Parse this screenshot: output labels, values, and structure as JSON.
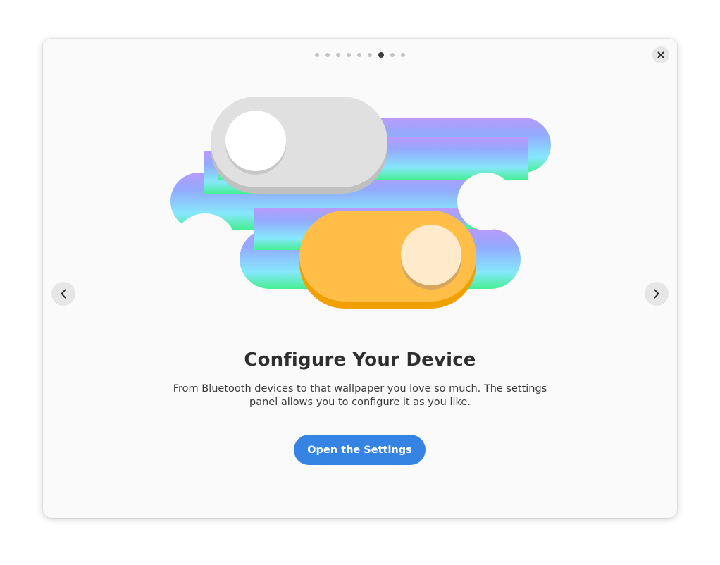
{
  "dialog": {
    "title": "Configure Your Device",
    "description": "From Bluetooth devices to that wallpaper you love so much. The settings panel allows you to configure it as you like.",
    "primary_button": "Open the Settings"
  },
  "pager": {
    "total_pages": 9,
    "current_page": 7
  },
  "icons": {
    "close": "close-icon",
    "previous": "chevron-left-icon",
    "next": "chevron-right-icon"
  },
  "colors": {
    "accent": "#3584e4",
    "toggle_on": "#ffbe48",
    "toggle_off": "#e0e0e0"
  }
}
